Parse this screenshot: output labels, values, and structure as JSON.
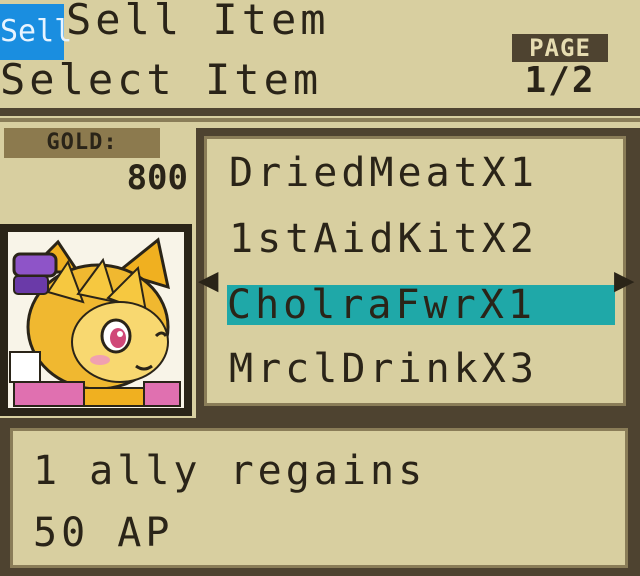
{
  "header": {
    "mode_badge": "Sell",
    "title": "Sell Item",
    "subtitle": "Select Item",
    "page_label": "PAGE",
    "page_value": "1/2"
  },
  "gold": {
    "label": "GOLD:",
    "value": "800"
  },
  "portrait": {
    "icon": "fox-girl-portrait"
  },
  "items": [
    {
      "label": "DriedMeatX1",
      "selected": false
    },
    {
      "label": "1stAidKitX2",
      "selected": false
    },
    {
      "label": "CholraFwrX1",
      "selected": true
    },
    {
      "label": "MrclDrinkX3",
      "selected": false
    }
  ],
  "arrows": {
    "left": "◀",
    "right": "▶"
  },
  "description": {
    "line1": "1 ally regains",
    "line2": "50 AP"
  },
  "colors": {
    "background": "#d8cfa0",
    "frame": "#4e4330",
    "selection": "#1fa8a8",
    "badge": "#1a8ee0"
  }
}
